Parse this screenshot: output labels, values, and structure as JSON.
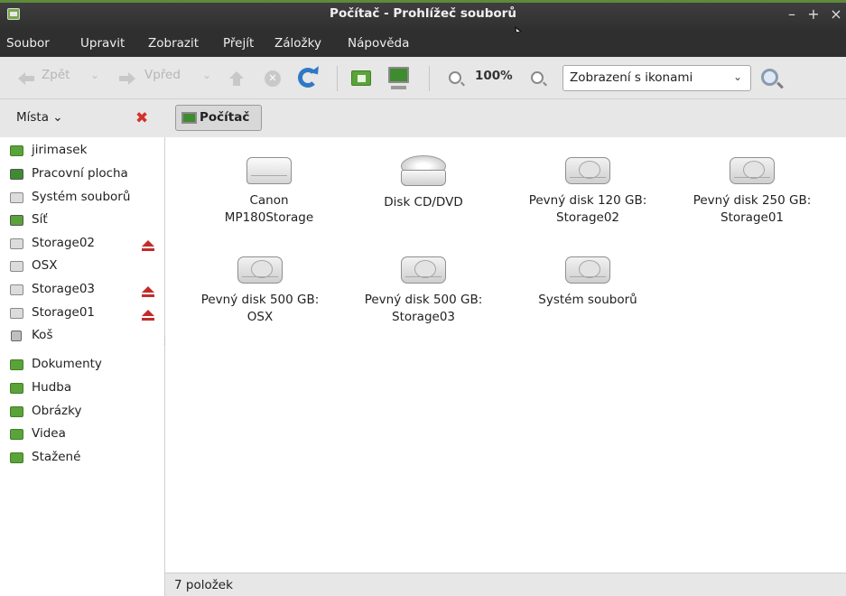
{
  "window": {
    "title": "Počítač - Prohlížeč souborů",
    "min": "–",
    "max": "+",
    "close": "×"
  },
  "menu": [
    "Soubor",
    "Upravit",
    "Zobrazit",
    "Přejít",
    "Záložky",
    "Nápověda"
  ],
  "toolbar": {
    "back": "Zpět",
    "forward": "Vpřed",
    "zoom": "100%",
    "view_mode": "Zobrazení s ikonami"
  },
  "locbar": {
    "places": "Místa",
    "crumb": "Počítač"
  },
  "sidebar": {
    "devices": [
      {
        "label": "jirimasek",
        "icon": "home-folder-icon",
        "eject": false
      },
      {
        "label": "Pracovní plocha",
        "icon": "desktop-icon",
        "eject": false
      },
      {
        "label": "Systém souborů",
        "icon": "drive-icon",
        "eject": false
      },
      {
        "label": "Síť",
        "icon": "network-icon",
        "eject": false
      },
      {
        "label": "Storage02",
        "icon": "drive-icon",
        "eject": true
      },
      {
        "label": "OSX",
        "icon": "drive-icon",
        "eject": false
      },
      {
        "label": "Storage03",
        "icon": "drive-icon",
        "eject": true
      },
      {
        "label": "Storage01",
        "icon": "drive-icon",
        "eject": true
      },
      {
        "label": "Koš",
        "icon": "trash-icon",
        "eject": false
      }
    ],
    "bookmarks": [
      {
        "label": "Dokumenty",
        "icon": "documents-folder-icon"
      },
      {
        "label": "Hudba",
        "icon": "music-folder-icon"
      },
      {
        "label": "Obrázky",
        "icon": "pictures-folder-icon"
      },
      {
        "label": "Videa",
        "icon": "videos-folder-icon"
      },
      {
        "label": "Stažené",
        "icon": "downloads-folder-icon"
      }
    ]
  },
  "items": [
    {
      "line1": "Canon",
      "line2": "MP180Storage",
      "icon": "removable-drive-icon"
    },
    {
      "line1": "Disk CD/DVD",
      "line2": "",
      "icon": "cd-dvd-icon"
    },
    {
      "line1": "Pevný disk 120 GB:",
      "line2": "Storage02",
      "icon": "hard-disk-icon"
    },
    {
      "line1": "Pevný disk 250 GB:",
      "line2": "Storage01",
      "icon": "hard-disk-icon"
    },
    {
      "line1": "Pevný disk 500 GB:",
      "line2": "OSX",
      "icon": "hard-disk-icon"
    },
    {
      "line1": "Pevný disk 500 GB:",
      "line2": "Storage03",
      "icon": "hard-disk-icon"
    },
    {
      "line1": "Systém souborů",
      "line2": "",
      "icon": "hard-disk-icon"
    }
  ],
  "status": "7 položek",
  "colors": {
    "accent_green": "#5f8a3a",
    "eject_red": "#c32b2b",
    "dark_chrome": "#2f2f2f"
  }
}
